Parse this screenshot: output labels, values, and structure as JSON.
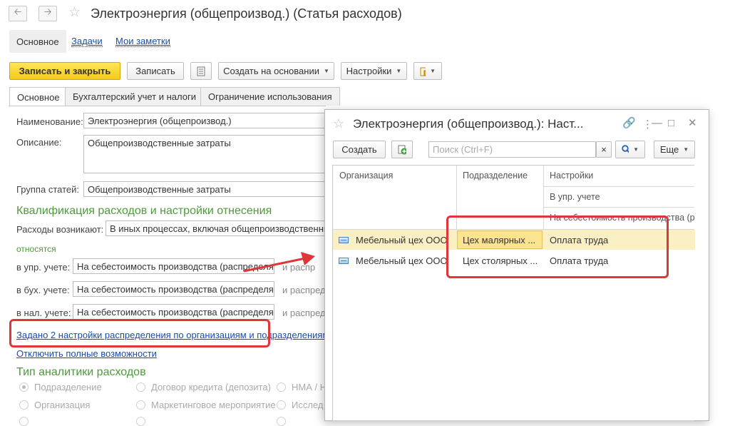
{
  "window": {
    "title": "Электроэнергия (общепроизвод.) (Статья расходов)",
    "back_icon": "arrow-left-icon",
    "forward_icon": "arrow-right-icon",
    "favorite_icon": "star-icon"
  },
  "nav_tabs": [
    {
      "label": "Основное"
    },
    {
      "label": "Задачи"
    },
    {
      "label": "Мои заметки"
    }
  ],
  "toolbar": {
    "save_close": "Записать и закрыть",
    "save": "Записать",
    "create_based": "Создать на основании",
    "settings": "Настройки"
  },
  "form_tabs": [
    {
      "label": "Основное"
    },
    {
      "label": "Бухгалтерский учет и налоги"
    },
    {
      "label": "Ограничение использования"
    }
  ],
  "form": {
    "name_label": "Наименование:",
    "name_value": "Электроэнергия (общепроизвод.)",
    "description_label": "Описание:",
    "description_value": "Общепроизводственные затраты",
    "group_label": "Группа статей:",
    "group_value": "Общепроизводственные затраты",
    "section_title": "Квалификация расходов и настройки отнесения",
    "expenses_label": "Расходы возникают:",
    "expenses_value": "В иных процессах, включая общепроизводственны",
    "relate_label": "относятся",
    "mgmt_label": "в упр. учете:",
    "mgmt_value": "На себестоимость производства (распределяе",
    "mgmt_tail": "и распр",
    "acc_label": "в бух. учете:",
    "acc_value": "На себестоимость производства (распределяе",
    "acc_tail": "и распред",
    "tax_label": "в нал. учете:",
    "tax_value": "На себестоимость производства (распределяе",
    "tax_tail": "и распред",
    "settings_link": "Задано 2 настройки распределения по организациям и подразделениям",
    "disable_link": "Отключить полные возможности",
    "analytics_title": "Тип аналитики расходов",
    "radios": [
      {
        "label": "Подразделение"
      },
      {
        "label": "Договор кредита (депозита)"
      },
      {
        "label": "НМА / Н"
      },
      {
        "label": "Организация"
      },
      {
        "label": "Маркетинговое мероприятие"
      },
      {
        "label": "Исслед"
      }
    ]
  },
  "dialog": {
    "title": "Электроэнергия (общепроизвод.): Наст...",
    "create": "Создать",
    "search_placeholder": "Поиск (Ctrl+F)",
    "clear": "×",
    "more": "Еще",
    "columns": {
      "org": "Организация",
      "dept": "Подразделение",
      "settings": "Настройки",
      "settings_mgmt": "В упр. учете",
      "settings_cost": "На себестоимость производства (р"
    },
    "rows": [
      {
        "org": "Мебельный цех ООО",
        "dept": "Цех малярных ...",
        "setting": "Оплата труда"
      },
      {
        "org": "Мебельный цех ООО",
        "dept": "Цех столярных ...",
        "setting": "Оплата труда"
      }
    ]
  }
}
